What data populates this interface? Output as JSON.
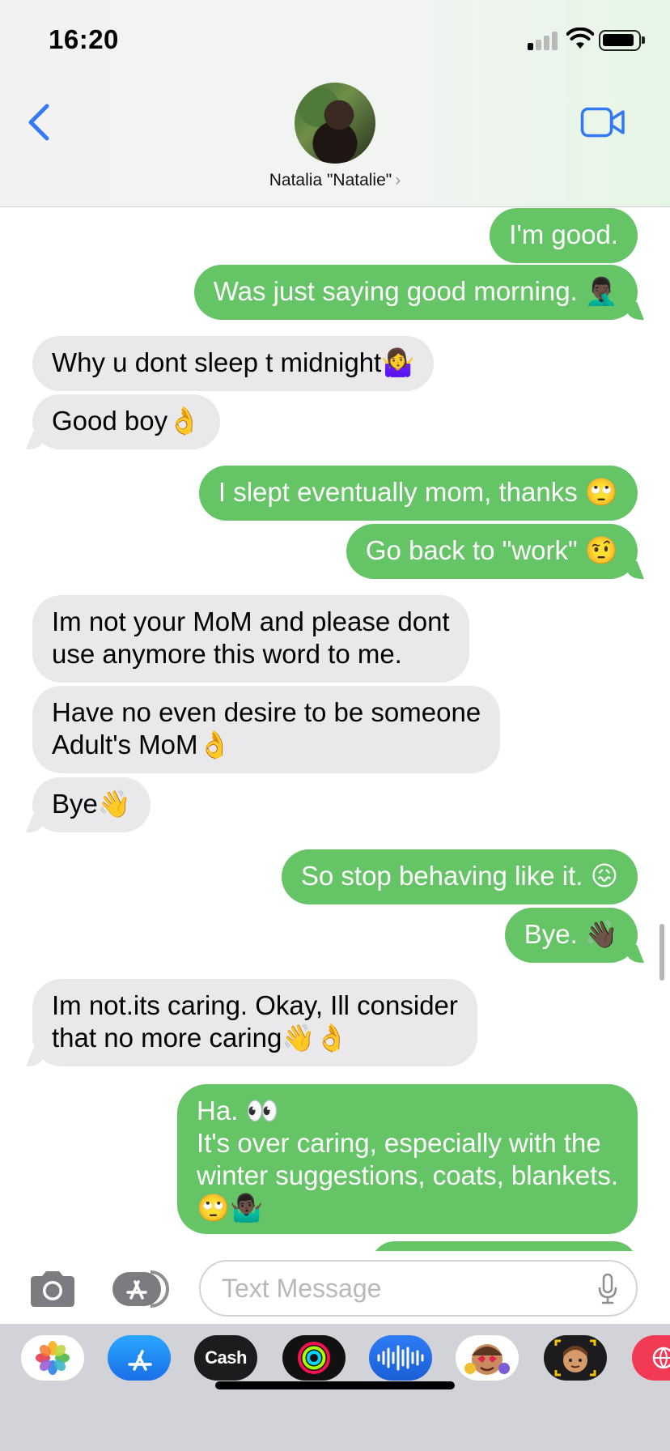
{
  "status_bar": {
    "time": "16:20"
  },
  "header": {
    "contact_name": "Natalia \"Natalie\"",
    "chevron": "›",
    "accent_color": "#3478f6"
  },
  "messages": [
    {
      "from": "me",
      "text": "I'm good."
    },
    {
      "from": "me",
      "text": "Was just saying good morning. 🤦🏿‍♂️"
    },
    {
      "from": "them",
      "text": "Why u dont sleep t midnight🤷‍♀️"
    },
    {
      "from": "them",
      "text": "Good boy👌"
    },
    {
      "from": "me",
      "text": "I slept eventually mom, thanks 🙄"
    },
    {
      "from": "me",
      "text": "Go back to \"work\" 🤨"
    },
    {
      "from": "them",
      "text": "Im not your MoM and please dont\nuse anymore this word to me."
    },
    {
      "from": "them",
      "text": "Have no even desire to be someone\nAdult's MoM👌"
    },
    {
      "from": "them",
      "text": "Bye👋"
    },
    {
      "from": "me",
      "text": "So stop behaving like it. 😖"
    },
    {
      "from": "me",
      "text": "Bye. 👋🏿"
    },
    {
      "from": "them",
      "text": "Im not.its caring. Okay, Ill consider\nthat no more caring👋👌"
    },
    {
      "from": "me",
      "text": "Ha. 👀\nIt's over caring, especially with the\nwinter suggestions, coats, blankets.\n🙄🤷🏿‍♂️"
    }
  ],
  "input": {
    "placeholder": "Text Message"
  },
  "app_drawer": {
    "apps": [
      {
        "name": "photos-app-icon"
      },
      {
        "name": "app-store-icon"
      },
      {
        "name": "apple-cash-icon",
        "label": "Cash"
      },
      {
        "name": "activity-icon"
      },
      {
        "name": "audio-message-icon"
      },
      {
        "name": "animoji-stickers-icon"
      },
      {
        "name": "memoji-icon"
      },
      {
        "name": "web-search-icon"
      }
    ]
  },
  "colors": {
    "sent_bubble": "#65c466",
    "received_bubble": "#e9e9eb"
  }
}
